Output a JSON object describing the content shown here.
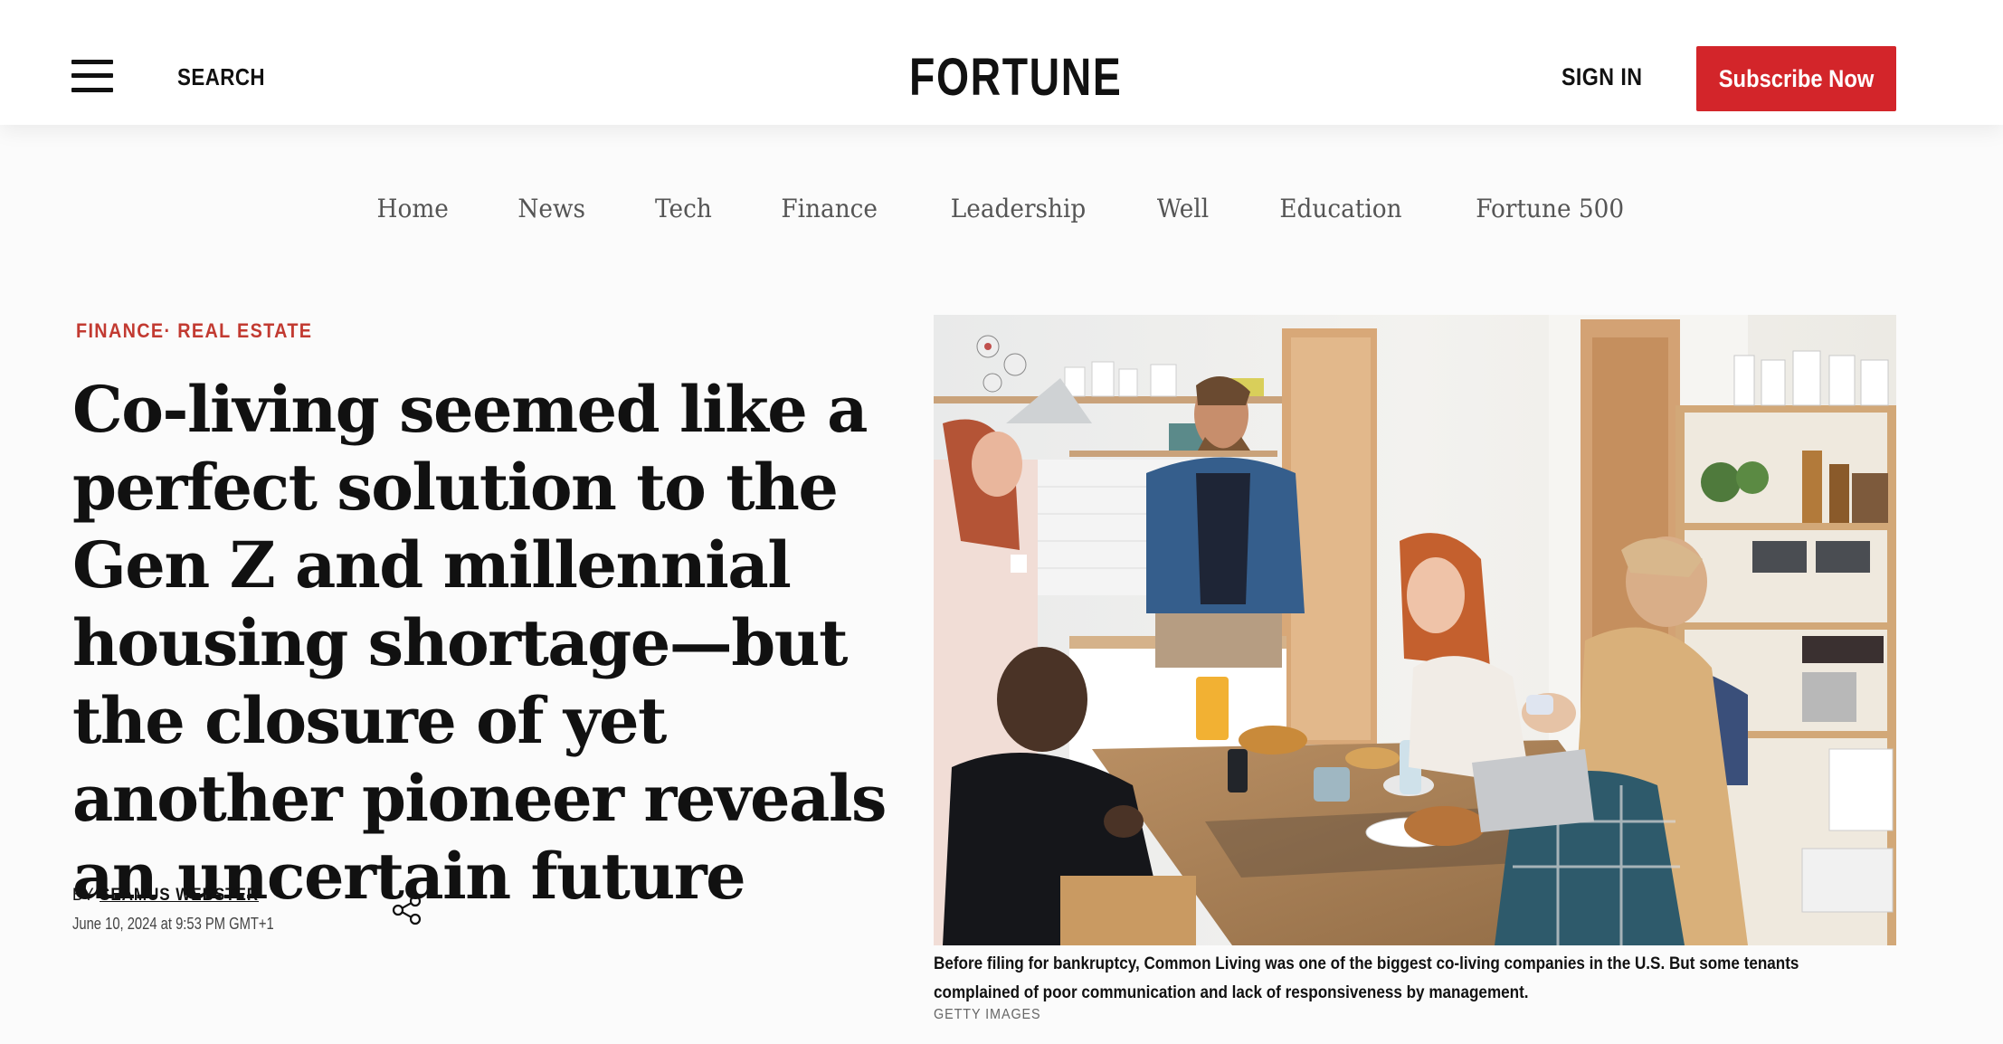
{
  "header": {
    "search_label": "SEARCH",
    "logo": "FORTUNE",
    "signin_label": "SIGN IN",
    "subscribe_label": "Subscribe Now"
  },
  "nav": {
    "items": [
      "Home",
      "News",
      "Tech",
      "Finance",
      "Leadership",
      "Well",
      "Education",
      "Fortune 500"
    ]
  },
  "article": {
    "category_1": "FINANCE",
    "category_separator": "·",
    "category_2": "REAL ESTATE",
    "headline": "Co-living seemed like a perfect solution to the Gen Z and millennial housing shortage—but the closure of yet another pioneer reveals an uncertain future",
    "byline_prefix": "BY",
    "author": "SEAMUS WEBSTER",
    "date": "June 10, 2024 at 9:53 PM GMT+1"
  },
  "image": {
    "caption": "Before filing for bankruptcy, Common Living was one of the biggest co-living companies in the U.S. But some tenants complained of poor communication and lack of responsiveness by management.",
    "credit": "GETTY IMAGES"
  },
  "icons": {
    "menu": "hamburger-menu-icon",
    "share": "share-icon"
  },
  "colors": {
    "accent_red": "#d3252a",
    "category_red": "#c23a31"
  }
}
